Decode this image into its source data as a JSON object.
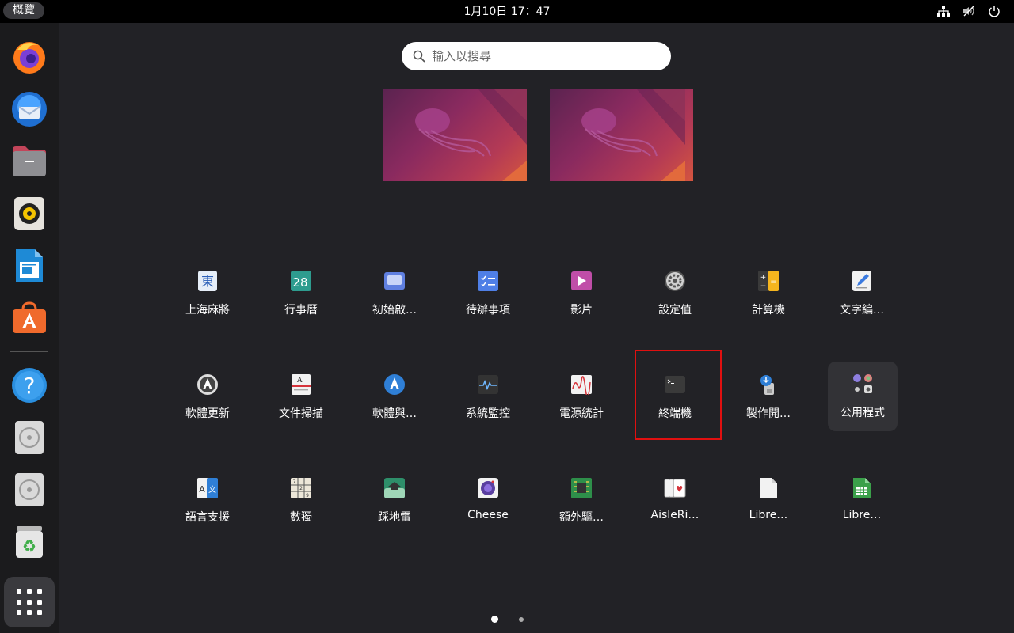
{
  "topbar": {
    "activities_label": "概覽",
    "clock": "1月10日  17：47",
    "tray_icons": [
      "network-icon",
      "volume-muted-icon",
      "power-icon"
    ]
  },
  "dock": {
    "items": [
      {
        "name": "firefox",
        "icon": "firefox-icon"
      },
      {
        "name": "thunderbird",
        "icon": "thunderbird-icon"
      },
      {
        "name": "files",
        "icon": "files-icon"
      },
      {
        "name": "rhythmbox",
        "icon": "rhythmbox-icon"
      },
      {
        "name": "writer",
        "icon": "writer-icon"
      },
      {
        "name": "app-center",
        "icon": "app-center-icon"
      },
      {
        "name": "help",
        "icon": "help-icon"
      },
      {
        "name": "disc-1",
        "icon": "disc-icon"
      },
      {
        "name": "disc-2",
        "icon": "disc-icon"
      },
      {
        "name": "trash",
        "icon": "trash-icon"
      }
    ],
    "show_apps_icon": "grid-icon"
  },
  "search": {
    "placeholder": "輸入以搜尋"
  },
  "workspaces": [
    "workspace-1",
    "workspace-2"
  ],
  "apps": {
    "row1": [
      {
        "label": "上海麻將",
        "icon": "mahjongg-icon",
        "glyph": "東"
      },
      {
        "label": "行事曆",
        "icon": "calendar-icon",
        "glyph": "28"
      },
      {
        "label": "初始啟…",
        "icon": "startup-disk-icon"
      },
      {
        "label": "待辦事項",
        "icon": "todo-icon"
      },
      {
        "label": "影片",
        "icon": "videos-icon"
      },
      {
        "label": "設定值",
        "icon": "settings-icon"
      },
      {
        "label": "計算機",
        "icon": "calculator-icon"
      },
      {
        "label": "文字編…",
        "icon": "text-editor-icon"
      }
    ],
    "row2": [
      {
        "label": "軟體更新",
        "icon": "software-updater-icon"
      },
      {
        "label": "文件掃描",
        "icon": "document-scanner-icon"
      },
      {
        "label": "軟體與…",
        "icon": "software-properties-icon"
      },
      {
        "label": "系統監控",
        "icon": "system-monitor-icon"
      },
      {
        "label": "電源統計",
        "icon": "power-statistics-icon"
      },
      {
        "label": "終端機",
        "icon": "terminal-icon"
      },
      {
        "label": "製作開…",
        "icon": "usb-creator-icon"
      },
      {
        "label": "公用程式",
        "icon": "utilities-folder-icon"
      }
    ],
    "row3": [
      {
        "label": "語言支援",
        "icon": "language-support-icon"
      },
      {
        "label": "數獨",
        "icon": "sudoku-icon"
      },
      {
        "label": "踩地雷",
        "icon": "mines-icon"
      },
      {
        "label": "Cheese",
        "icon": "cheese-icon"
      },
      {
        "label": "額外驅…",
        "icon": "additional-drivers-icon"
      },
      {
        "label": "AisleRi…",
        "icon": "aisleriot-icon"
      },
      {
        "label": "Libre…",
        "icon": "libreoffice-icon"
      },
      {
        "label": "Libre…",
        "icon": "libreoffice-calc-icon"
      }
    ]
  },
  "pagination": {
    "current_page": 1,
    "total_pages": 2
  }
}
